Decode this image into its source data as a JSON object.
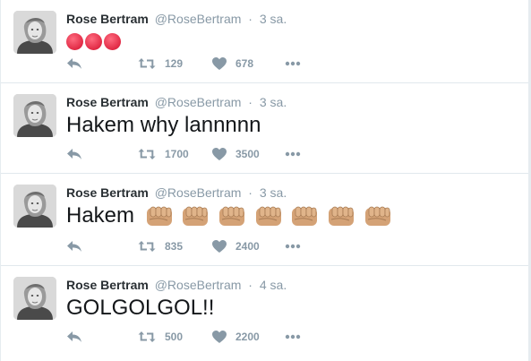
{
  "tweets": [
    {
      "name": "Rose Bertram",
      "handle": "@RoseBertram",
      "separator": "·",
      "time": "3 sa.",
      "text": "",
      "emoji": "angry-face",
      "emoji_count": 3,
      "retweets": "129",
      "likes": "678"
    },
    {
      "name": "Rose Bertram",
      "handle": "@RoseBertram",
      "separator": "·",
      "time": "3 sa.",
      "text": "Hakem why lannnnn",
      "retweets": "1700",
      "likes": "3500"
    },
    {
      "name": "Rose Bertram",
      "handle": "@RoseBertram",
      "separator": "·",
      "time": "3 sa.",
      "text": "Hakem",
      "emoji": "oncoming-fist",
      "emoji_count": 7,
      "retweets": "835",
      "likes": "2400"
    },
    {
      "name": "Rose Bertram",
      "handle": "@RoseBertram",
      "separator": "·",
      "time": "4 sa.",
      "text": "GOLGOLGOL!!",
      "retweets": "500",
      "likes": "2200"
    }
  ],
  "icons": {
    "reply": "reply-icon",
    "retweet": "retweet-icon",
    "like": "heart-icon",
    "more": "more-icon"
  },
  "colors": {
    "name": "#292f33",
    "muted": "#8899a6",
    "text": "#14171a",
    "divider": "#e1e8ed",
    "angry_emoji": "#e12a45",
    "fist_emoji": "#d4a276"
  }
}
